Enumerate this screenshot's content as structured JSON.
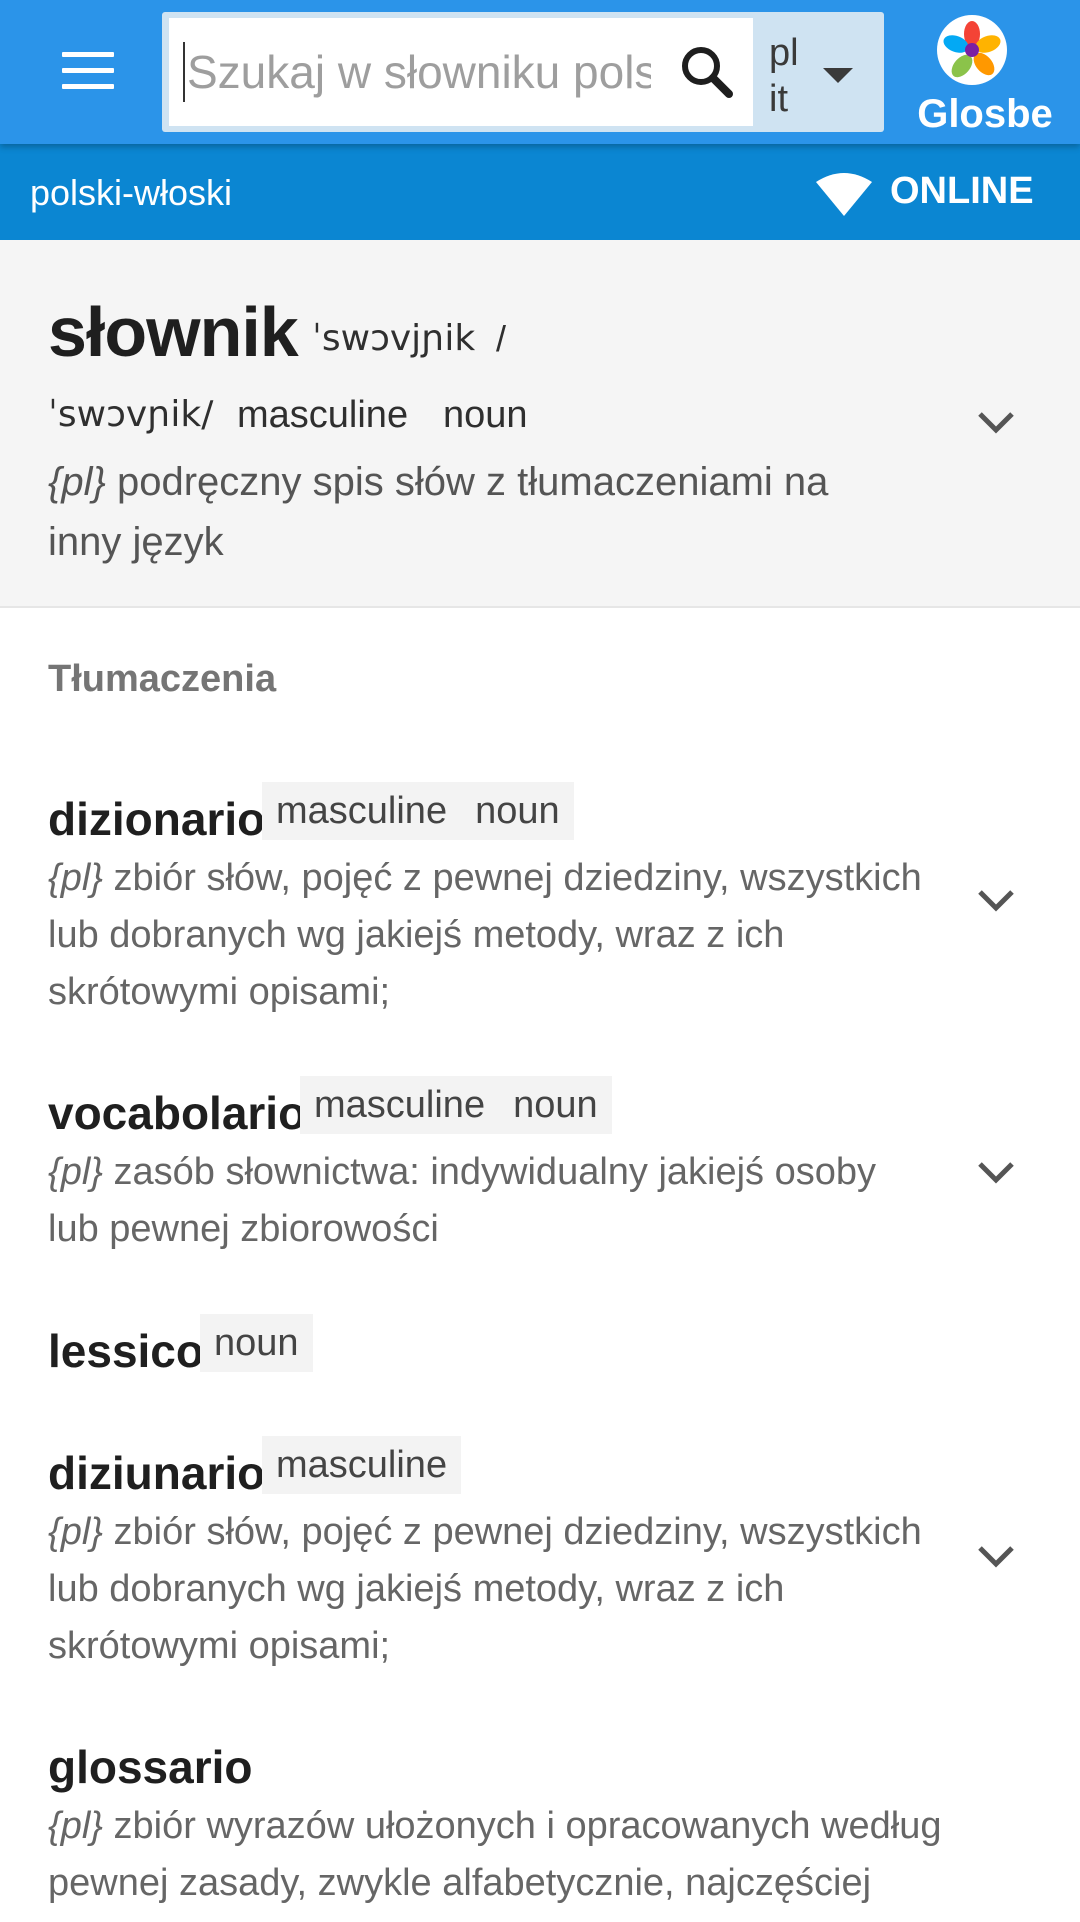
{
  "header": {
    "search_placeholder": "Szukaj w słowniku polsko-włoskim",
    "lang_from": "pl",
    "lang_to": "it",
    "logo_text": "Glosbe"
  },
  "subbar": {
    "pair": "polski-włoski",
    "status": "ONLINE"
  },
  "headword": {
    "word": "słownik",
    "pron1": "ˈswɔvjɲik",
    "slash": "/",
    "pron2": "ˈswɔvɲik/",
    "gender": "masculine",
    "pos": "noun",
    "lang_tag": "{pl}",
    "definition": "podręczny spis słów z tłumaczeniami na inny język"
  },
  "translations": {
    "title": "Tłumaczenia",
    "items": [
      {
        "term": "dizionario",
        "gender": "masculine",
        "pos": "noun",
        "lang_tag": "{pl}",
        "definition": "zbiór słów, pojęć z pewnej dziedziny, wszystkich lub dobranych wg jakiejś metody, wraz z ich skrótowymi opisami;"
      },
      {
        "term": "vocabolario",
        "gender": "masculine",
        "pos": "noun",
        "lang_tag": "{pl}",
        "definition": "zasób słownictwa: indywidualny jakiejś osoby lub pewnej zbiorowości"
      },
      {
        "term": "lessico",
        "pos": "noun"
      },
      {
        "term": "diziunario",
        "gender": "masculine",
        "lang_tag": "{pl}",
        "definition": "zbiór słów, pojęć z pewnej dziedziny, wszystkich lub dobranych wg jakiejś metody, wraz z ich skrótowymi opisami;"
      },
      {
        "term": "glossario",
        "lang_tag": "{pl}",
        "definition": "zbiór wyrazów ułożonych i opracowanych według pewnej zasady, zwykle alfabetycznie, najczęściej"
      }
    ]
  },
  "colors": {
    "appbar": "#2b94e9",
    "subbar": "#0b86d2",
    "head_card_bg": "#f5f5f5"
  },
  "icons": [
    "menu-icon",
    "search-icon",
    "caret-down-icon",
    "glosbe-logo-icon",
    "wifi-icon",
    "chevron-down-icon"
  ]
}
